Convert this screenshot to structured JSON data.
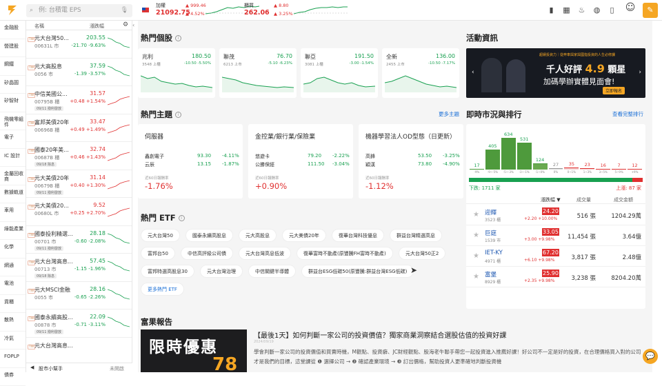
{
  "search": {
    "placeholder": "例: 台積電 EPS"
  },
  "indices": [
    {
      "name": "加權",
      "value": "21092.75",
      "change": "▲ 999.46",
      "pct": "▲ 4.52%"
    },
    {
      "name": "櫃買",
      "value": "262.06",
      "change": "▲ 8.80",
      "pct": "▲ 3.25%"
    }
  ],
  "categories": [
    "金融股",
    "營建股",
    "鋼鐵",
    "矽晶圓",
    "矽智財",
    "飛機零組件",
    "電子",
    "IC 設計",
    "金屬回收商",
    "數據軌道",
    "車用",
    "綠能產業",
    "化學",
    "網通",
    "電池",
    "貨櫃",
    "散熱",
    "冷氣",
    "FOPLP",
    "債券"
  ],
  "watchlist": {
    "header": {
      "name": "名稱",
      "change": "漲跌幅"
    },
    "items": [
      {
        "name": "元大台灣50...",
        "code": "00631L 市",
        "price": "203.55",
        "delta": "-21.70",
        "pct": "-9.63%",
        "dir": "dn",
        "tag": ""
      },
      {
        "name": "元大高股息",
        "code": "0056 市",
        "price": "37.59",
        "delta": "-1.39",
        "pct": "-3.57%",
        "dir": "dn",
        "tag": ""
      },
      {
        "name": "中信美國公...",
        "code": "00795B 櫃",
        "price": "31.57",
        "delta": "+0.48",
        "pct": "+1.54%",
        "dir": "up",
        "tag": "09/11 撥利發放"
      },
      {
        "name": "富邦美債20年",
        "code": "00696B 櫃",
        "price": "33.47",
        "delta": "+0.49",
        "pct": "+1.49%",
        "dir": "up",
        "tag": ""
      },
      {
        "name": "國泰20年美...",
        "code": "00687B 櫃",
        "price": "32.74",
        "delta": "+0.46",
        "pct": "+1.43%",
        "dir": "up",
        "tag": "09/18 除息"
      },
      {
        "name": "元大美債20年",
        "code": "00679B 櫃",
        "price": "31.14",
        "delta": "+0.40",
        "pct": "+1.30%",
        "dir": "up",
        "tag": "09/11 撥利發放"
      },
      {
        "name": "元大美債20...",
        "code": "00680L 市",
        "price": "9.52",
        "delta": "+0.25",
        "pct": "+2.70%",
        "dir": "up",
        "tag": ""
      },
      {
        "name": "國泰投利精選...",
        "code": "00701 市",
        "price": "28.18",
        "delta": "-0.60",
        "pct": "-2.08%",
        "dir": "dn",
        "tag": "09/11 撥利發放"
      },
      {
        "name": "元大台灣高息...",
        "code": "00713 市",
        "price": "57.45",
        "delta": "-1.15",
        "pct": "-1.96%",
        "dir": "dn",
        "tag": "09/18 除息"
      },
      {
        "name": "元大MSCI金融",
        "code": "0055 市",
        "price": "28.16",
        "delta": "-0.65",
        "pct": "-2.26%",
        "dir": "dn",
        "tag": ""
      },
      {
        "name": "國泰永續高股...",
        "code": "00878 市",
        "price": "22.09",
        "delta": "-0.71",
        "pct": "-3.11%",
        "dir": "dn",
        "tag": "09/11 撥利發放"
      },
      {
        "name": "元大台灣高息...",
        "code": "",
        "price": "",
        "delta": "",
        "pct": "",
        "dir": "dn",
        "tag": ""
      }
    ],
    "footer": {
      "label": "股市小幫手",
      "status": "未開啟"
    }
  },
  "hot_stocks": {
    "title": "熱門個股",
    "items": [
      {
        "name": "兆利",
        "price": "180.50",
        "info": "3548 上櫃",
        "delta": "-10.50",
        "pct": "-5.50%"
      },
      {
        "name": "聯茂",
        "price": "76.70",
        "info": "6213 上市",
        "delta": "-5.10",
        "pct": "-6.23%"
      },
      {
        "name": "聯亞",
        "price": "191.50",
        "info": "3081 上櫃",
        "delta": "-3.00",
        "pct": "-1.54%"
      },
      {
        "name": "全新",
        "price": "136.00",
        "info": "2455 上市",
        "delta": "-10.50",
        "pct": "-7.17%"
      }
    ]
  },
  "themes": {
    "title": "熱門主題",
    "more": "更多主題",
    "items": [
      {
        "title": "伺服器",
        "rows": [
          {
            "n": "鑫創電子",
            "p": "93.30",
            "c": "-4.11%"
          },
          {
            "n": "云辰",
            "p": "13.15",
            "c": "-1.87%"
          }
        ],
        "label": "近60日報酬率",
        "ret": "-1.76%",
        "dir": "up"
      },
      {
        "title": "金控業/銀行業/保險業",
        "rows": [
          {
            "n": "悠遊卡",
            "p": "79.20",
            "c": "-2.22%"
          },
          {
            "n": "公勝保經",
            "p": "111.50",
            "c": "-3.04%"
          }
        ],
        "label": "近60日報酬率",
        "ret": "+0.90%",
        "dir": "up"
      },
      {
        "title": "機器學習法人OD型態（日更新）",
        "rows": [
          {
            "n": "高鋒",
            "p": "53.50",
            "c": "-3.25%"
          },
          {
            "n": "穎漢",
            "p": "73.80",
            "c": "-4.90%"
          }
        ],
        "label": "近60日報酬率",
        "ret": "-1.12%",
        "dir": "up"
      }
    ]
  },
  "etf": {
    "title": "熱門 ETF",
    "tags": [
      "元大台灣50",
      "國泰永續高股息",
      "元大高股息",
      "元大美債20年",
      "復華台灣科技優息",
      "群益台灣精選高息",
      "富邦台50",
      "中信高評級公司債",
      "元大台灣高息低波",
      "復華富時不動產(原豐騰FH富時不動產)",
      "元大台灣50正2",
      "富邦特選高股息30",
      "元大台灣治理",
      "中信關鍵半導體",
      "群益台ESG低碳50(原豐騰:群益台灣ESG低碳)"
    ],
    "more": "更多熱門 ETF"
  },
  "events": {
    "title": "活動資訊",
    "banner_top": "超績投資力｜從奔車與家與國指投資的人生必修課",
    "banner_main": "千人好評",
    "banner_num": "4.9",
    "banner_unit": "顆星",
    "banner_sub": "加碼學辦實體見面會!",
    "banner_btn": "立即報名"
  },
  "market": {
    "title": "即時市況與排行",
    "more": "查看完整排行",
    "bins": [
      "-9%",
      "-9~-5%",
      "-5~-3%",
      "-3~-1%",
      "-1~0%",
      "0%",
      "0~1%",
      "1~3%",
      "3~5%",
      "5~9%",
      "+9%"
    ],
    "counts": [
      17,
      405,
      634,
      531,
      124,
      27,
      35,
      23,
      16,
      7,
      12
    ],
    "down_label": "下跌: 1711 家",
    "up_label": "上漲: 87 家",
    "cols": {
      "change": "漲跌幅 ▼",
      "vol": "成交量",
      "amt": "成交金額"
    },
    "rows": [
      {
        "name": "迎輝",
        "code": "3523 櫃",
        "price": "24.20",
        "delta": "+2.20",
        "pct": "+10.00%",
        "vol": "516 張",
        "amt": "1204.29萬"
      },
      {
        "name": "巨庭",
        "code": "1539 市",
        "price": "33.05",
        "delta": "+3.00",
        "pct": "+9.98%",
        "vol": "11,454 張",
        "amt": "3.64億"
      },
      {
        "name": "IET-KY",
        "code": "4971 櫃",
        "price": "67.20",
        "delta": "+6.10",
        "pct": "+9.98%",
        "vol": "3,817 張",
        "amt": "2.48億"
      },
      {
        "name": "富堡",
        "code": "8929 櫃",
        "price": "25.90",
        "delta": "+2.35",
        "pct": "+9.98%",
        "vol": "3,238 張",
        "amt": "8204.20萬"
      }
    ]
  },
  "report": {
    "title": "富果報告",
    "image_text": "限時優惠",
    "image_num": "78",
    "headline": "【最後1天】如何判斷一家公司的投資價值？獨家商業洞察結合選股估值的投資好課",
    "date": "2024/09/19",
    "body": "學會判斷一家公司的投資價值和買賣時機，M觀點、投資癖、JC財經觀點、股海老牛聯手帶您一起投資進入推薦好課！好公司不一定是好的投資，在合理價格買入對的公司才是我們的目標，這堂課從 ❶ 選擇公司 → ❷ 確認產業環境 → ❸ 訂出價格，幫助投資人更準確地判斷投資機"
  },
  "colors": {
    "up": "#e03030",
    "down": "#18a050",
    "accent": "#f5a623",
    "link": "#1a6fd6"
  }
}
